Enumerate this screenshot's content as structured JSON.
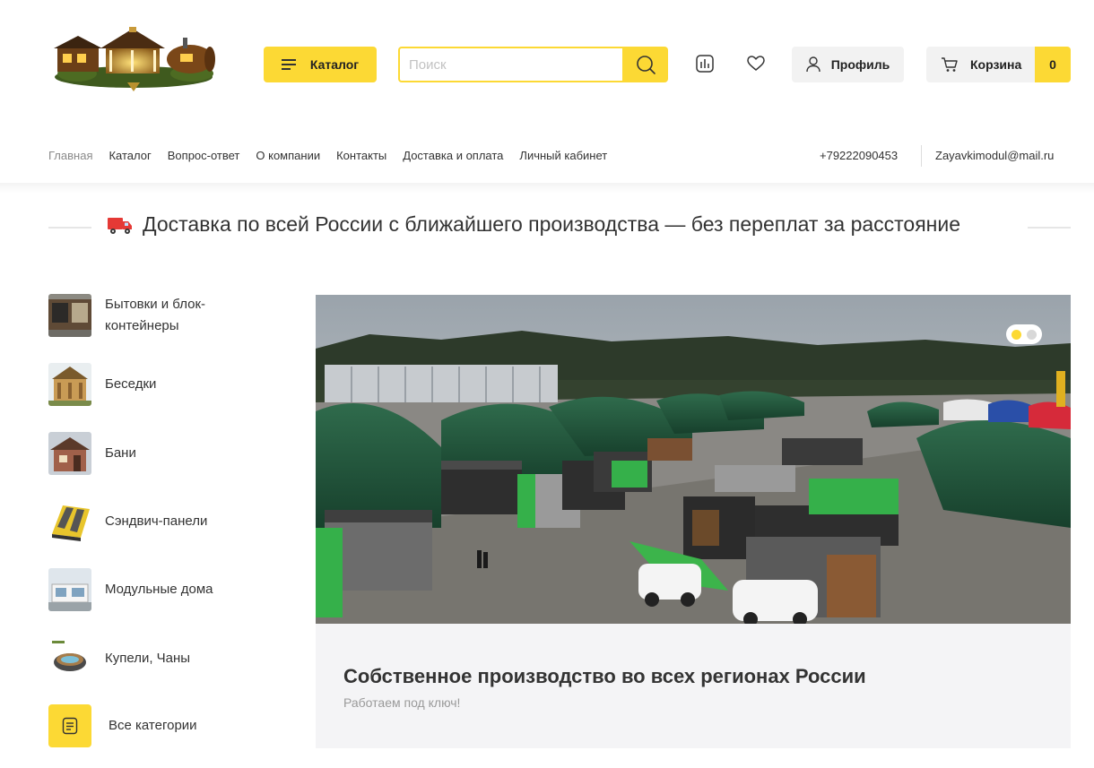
{
  "colors": {
    "accent": "#fcd934",
    "text": "#333333",
    "muted": "#8a8a8a",
    "light_bg": "#f2f2f2",
    "slider_bg": "#f4f4f6"
  },
  "header": {
    "logo_icon": "gazebo-bathhouse-logo",
    "catalog_button": {
      "label": "Каталог",
      "icon": "burger-menu-icon"
    },
    "search": {
      "placeholder": "Поиск",
      "value": "",
      "icon": "search-icon"
    },
    "compare_icon": "compare-chart-icon",
    "favorites_icon": "heart-icon",
    "profile_button": {
      "label": "Профиль",
      "icon": "user-icon"
    },
    "cart_button": {
      "label": "Корзина",
      "count": "0",
      "icon": "cart-icon"
    }
  },
  "nav": {
    "links": [
      "Главная",
      "Каталог",
      "Вопрос-ответ",
      "О компании",
      "Контакты",
      "Доставка и оплата",
      "Личный кабинет"
    ],
    "active_index": 0,
    "phone": "+79222090453",
    "email": "Zayavkimodul@mail.ru"
  },
  "promo": {
    "icon": "delivery-truck-emoji",
    "text": "Доставка по всей России с ближайшего производства — без переплат за расстояние"
  },
  "sidebar": {
    "categories": [
      {
        "label": "Бытовки и блок-контейнеры",
        "icon": "cabin-container-thumb"
      },
      {
        "label": "Беседки",
        "icon": "gazebo-thumb"
      },
      {
        "label": "Бани",
        "icon": "bathhouse-thumb"
      },
      {
        "label": "Сэндвич-панели",
        "icon": "sandwich-panel-thumb"
      },
      {
        "label": "Модульные дома",
        "icon": "modular-house-thumb"
      },
      {
        "label": "Купели, Чаны",
        "icon": "hot-tub-thumb"
      }
    ],
    "all_categories": {
      "label": "Все категории",
      "icon": "list-document-icon"
    }
  },
  "slider": {
    "image": "production-yard-aerial-photo",
    "slides_total": 2,
    "active_slide": 1,
    "title": "Собственное производство во всех регионах России",
    "subtitle": "Работаем под ключ!"
  }
}
